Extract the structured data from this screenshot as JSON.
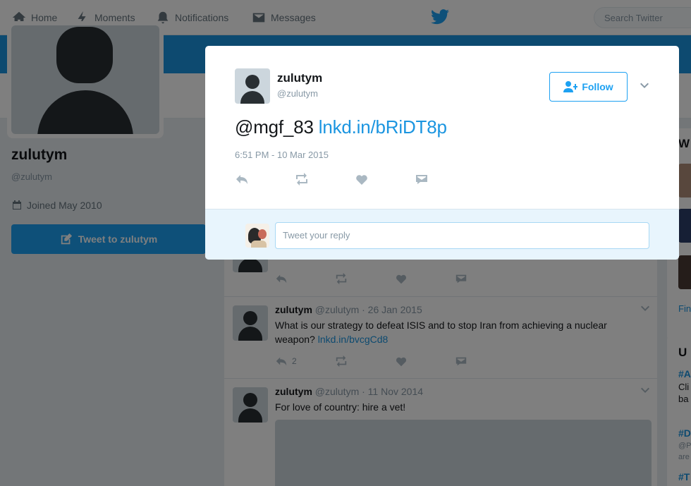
{
  "nav": {
    "home": "Home",
    "moments": "Moments",
    "notifications": "Notifications",
    "messages": "Messages",
    "search_placeholder": "Search Twitter"
  },
  "profile": {
    "name": "zulutym",
    "handle": "@zulutym",
    "joined": "Joined May 2010",
    "tweet_to": "Tweet to zulutym"
  },
  "timeline": [
    {
      "name": "zulutym",
      "meta": "@zulutym · 26 Jan 2015",
      "text": "What is our strategy to defeat ISIS and to stop Iran from achieving a nuclear weapon?",
      "link": "lnkd.in/bvcgCd8",
      "reply_count": "2"
    },
    {
      "name": "zulutym",
      "meta": "@zulutym · 11 Nov 2014",
      "text": "For love of country: hire a vet!"
    }
  ],
  "sidebar": {
    "who_to_follow_initial": "W",
    "find_link": "Fin",
    "trends_initial": "U",
    "trend_1": "#A",
    "trend_1_text": "Cli",
    "trend_1_text2": "ba",
    "trend_2": "#D",
    "trend_2_handle": "@P",
    "trend_2_text": "are",
    "trend_3": "#T"
  },
  "modal": {
    "name": "zulutym",
    "handle": "@zulutym",
    "follow_label": "Follow",
    "tweet_mention": "@mgf_83",
    "tweet_link": "lnkd.in/bRiDT8p",
    "timestamp": "6:51 PM - 10 Mar 2015",
    "reply_placeholder": "Tweet your reply"
  },
  "colors": {
    "brand": "#1da1f2",
    "link": "#1b95e0",
    "cover": "#1b95e0"
  }
}
